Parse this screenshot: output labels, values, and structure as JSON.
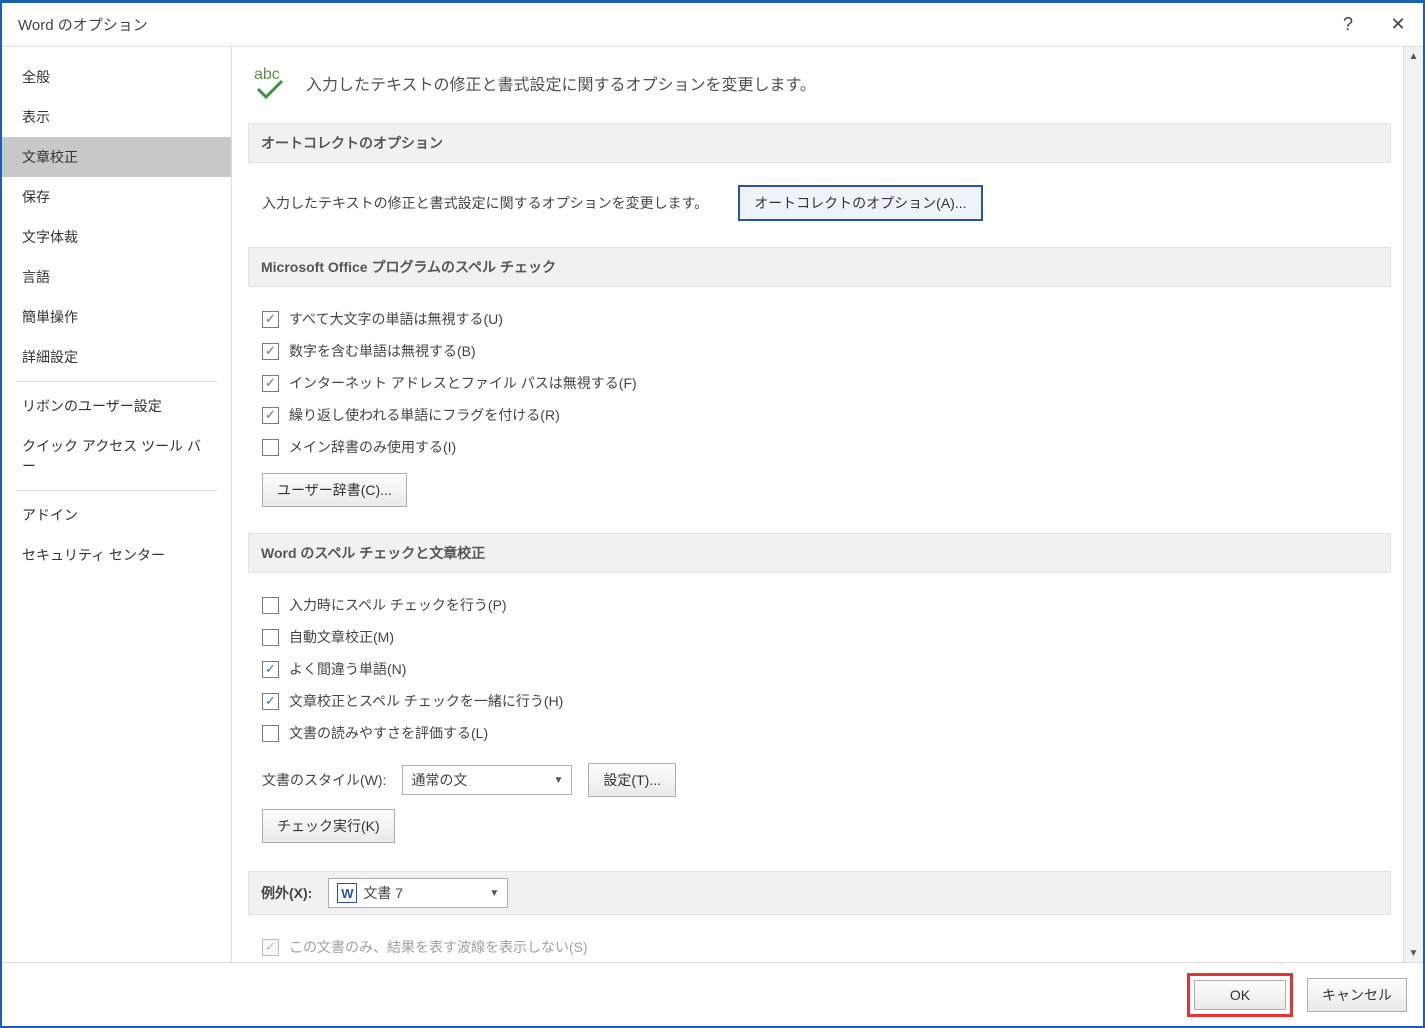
{
  "window": {
    "title": "Word のオプション"
  },
  "titlebar": {
    "help_tooltip": "?",
    "close_tooltip": "✕"
  },
  "sidebar": {
    "items": [
      "全般",
      "表示",
      "文章校正",
      "保存",
      "文字体裁",
      "言語",
      "簡単操作",
      "詳細設定"
    ],
    "group2": [
      "リボンのユーザー設定",
      "クイック アクセス ツール バー"
    ],
    "group3": [
      "アドイン",
      "セキュリティ センター"
    ],
    "selected_index": 2
  },
  "hero": {
    "icon_label": "abc",
    "text": "入力したテキストの修正と書式設定に関するオプションを変更します。"
  },
  "section_autocorrect": {
    "heading": "オートコレクトのオプション",
    "desc": "入力したテキストの修正と書式設定に関するオプションを変更します。",
    "button": "オートコレクトのオプション(A)...",
    "button_accel": "A"
  },
  "section_office_spell": {
    "heading": "Microsoft Office プログラムのスペル チェック",
    "items": [
      {
        "label": "すべて大文字の単語は無視する(U)",
        "accel": "U",
        "checked": true
      },
      {
        "label": "数字を含む単語は無視する(B)",
        "accel": "B",
        "checked": true
      },
      {
        "label": "インターネット アドレスとファイル パスは無視する(F)",
        "accel": "F",
        "checked": true
      },
      {
        "label": "繰り返し使われる単語にフラグを付ける(R)",
        "accel": "R",
        "checked": true
      },
      {
        "label": "メイン辞書のみ使用する(I)",
        "accel": "I",
        "checked": false
      }
    ],
    "user_dict_button": "ユーザー辞書(C)...",
    "user_dict_accel": "C"
  },
  "section_word_spell": {
    "heading": "Word のスペル チェックと文章校正",
    "items": [
      {
        "label": "入力時にスペル チェックを行う(P)",
        "accel": "P",
        "checked": false
      },
      {
        "label": "自動文章校正(M)",
        "accel": "M",
        "checked": false
      },
      {
        "label": "よく間違う単語(N)",
        "accel": "N",
        "checked": true
      },
      {
        "label": "文章校正とスペル チェックを一緒に行う(H)",
        "accel": "H",
        "checked": true
      },
      {
        "label": "文書の読みやすさを評価する(L)",
        "accel": "L",
        "checked": false
      }
    ],
    "style_label": "文書のスタイル(W):",
    "style_accel": "W",
    "style_value": "通常の文",
    "settings_button": "設定(T)...",
    "settings_accel": "T",
    "recheck_button": "チェック実行(K)",
    "recheck_accel": "K"
  },
  "section_exceptions": {
    "label": "例外(X):",
    "accel": "X",
    "doc_value": "文書 7",
    "item": {
      "label": "この文書のみ、結果を表す波線を表示しない(S)",
      "accel": "S",
      "checked": true,
      "disabled": true
    }
  },
  "footer": {
    "ok": "OK",
    "cancel": "キャンセル"
  }
}
